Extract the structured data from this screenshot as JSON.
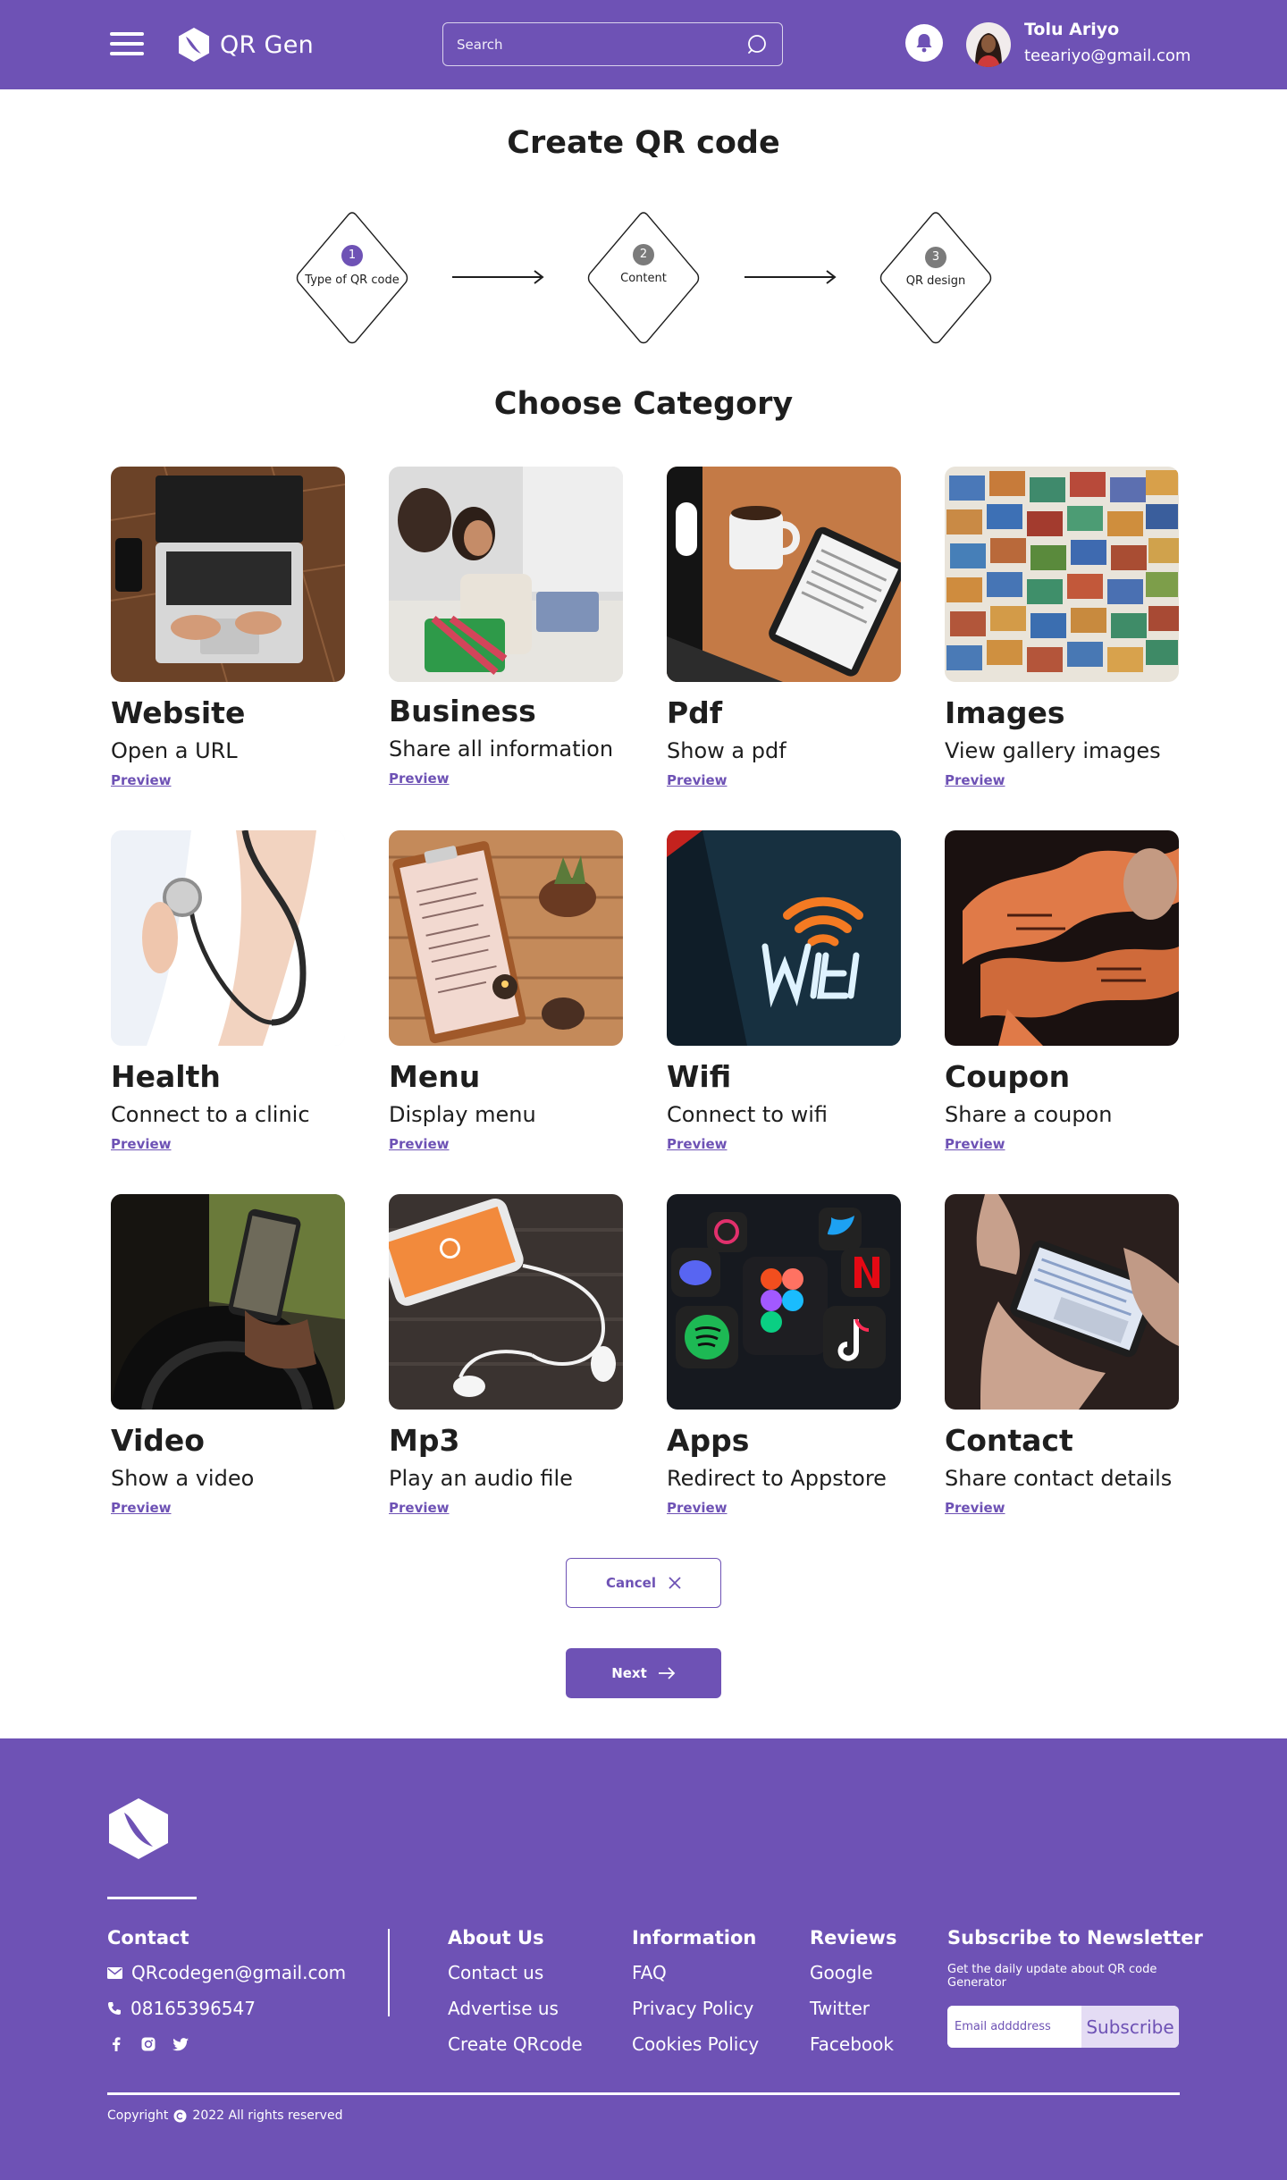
{
  "header": {
    "brand": "QR Gen",
    "search_placeholder": "Search",
    "user": {
      "name": "Tolu Ariyo",
      "email": "teeariyo@gmail.com"
    }
  },
  "page_title": "Create QR code",
  "stepper": [
    {
      "number": "1",
      "label": "Type of QR code",
      "active": true
    },
    {
      "number": "2",
      "label": "Content",
      "active": false
    },
    {
      "number": "3",
      "label": "QR design",
      "active": false
    }
  ],
  "section_title": "Choose Category",
  "categories": [
    {
      "title": "Website",
      "description": "Open a URL",
      "link": "Preview",
      "image": "laptop-photo"
    },
    {
      "title": "Business",
      "description": "Share all information",
      "link": "Preview",
      "image": "shopping-women-photo"
    },
    {
      "title": "Pdf",
      "description": "Show a pdf",
      "link": "Preview",
      "image": "tablet-coffee-photo"
    },
    {
      "title": "Images",
      "description": "View gallery images",
      "link": "Preview",
      "image": "postcards-photo"
    },
    {
      "title": "Health",
      "description": "Connect to a clinic",
      "link": "Preview",
      "image": "stethoscope-photo"
    },
    {
      "title": "Menu",
      "description": "Display menu",
      "link": "Preview",
      "image": "menu-board-photo"
    },
    {
      "title": "Wifi",
      "description": "Connect to wifi",
      "link": "Preview",
      "image": "wifi-sign-photo"
    },
    {
      "title": "Coupon",
      "description": "Share a coupon",
      "link": "Preview",
      "image": "coupon-tickets-photo"
    },
    {
      "title": "Video",
      "description": "Show a video",
      "link": "Preview",
      "image": "phone-in-car-photo"
    },
    {
      "title": "Mp3",
      "description": "Play an audio file",
      "link": "Preview",
      "image": "earphones-photo"
    },
    {
      "title": "Apps",
      "description": "Redirect to Appstore",
      "link": "Preview",
      "image": "app-icons-photo"
    },
    {
      "title": "Contact",
      "description": "Share contact details",
      "link": "Preview",
      "image": "phone-hands-photo"
    }
  ],
  "buttons": {
    "cancel": "Cancel",
    "next": "Next"
  },
  "footer": {
    "contact": {
      "heading": "Contact",
      "email": "QRcodegen@gmail.com",
      "phone": "08165396547",
      "social": [
        "facebook-icon",
        "instagram-icon",
        "twitter-icon"
      ]
    },
    "columns": [
      {
        "heading": "About Us",
        "items": [
          "Contact us",
          "Advertise us",
          "Create QRcode"
        ]
      },
      {
        "heading": "Information",
        "items": [
          "FAQ",
          "Privacy Policy",
          "Cookies Policy"
        ]
      },
      {
        "heading": "Reviews",
        "items": [
          "Google",
          "Twitter",
          "Facebook"
        ]
      }
    ],
    "newsletter": {
      "heading": "Subscribe to Newsletter",
      "subtitle": "Get the daily update about QR code Generator",
      "placeholder": "Email addddress",
      "button": "Subscribe"
    },
    "copyright": "2022 All rights reserved",
    "copyright_prefix": "Copyright"
  },
  "colors": {
    "brand": "#6e52b5",
    "text": "#1e1e1e",
    "white": "#ffffff"
  }
}
